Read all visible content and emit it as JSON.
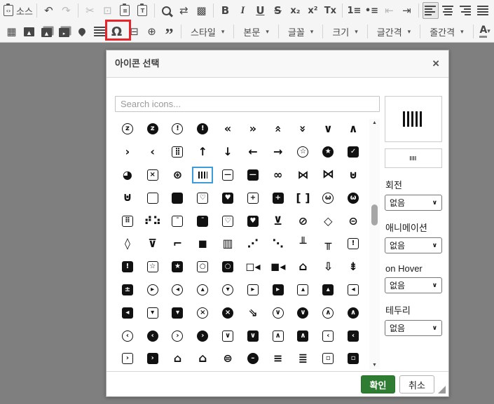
{
  "colors": {
    "overlay": "#7f7f7f",
    "toolbar_bg": "#f5f5f5",
    "dialog_header_bg": "#f8f8f8",
    "selection_blue": "#3d9bd9",
    "annotation_red": "#e8232a",
    "confirm_green": "#2e7d32",
    "icon_black": "#111111"
  },
  "toolbar": {
    "row1_groups": [
      [
        {
          "n": "source-button",
          "k": "src",
          "label": "소스"
        }
      ],
      [
        {
          "n": "undo-button",
          "k": "g",
          "g": "↶"
        },
        {
          "n": "redo-button",
          "k": "g",
          "g": "↷",
          "c": "disabled"
        }
      ],
      [
        {
          "n": "cut-button",
          "k": "g",
          "g": "✂",
          "c": "disabled"
        },
        {
          "n": "copy-button",
          "k": "g",
          "g": "⊡",
          "c": "disabled"
        },
        {
          "n": "paste-button",
          "k": "chip",
          "g": "≡"
        },
        {
          "n": "paste-from-word-button",
          "k": "chip",
          "g": "T"
        }
      ],
      [
        {
          "n": "find-button",
          "k": "mag"
        },
        {
          "n": "replace-button",
          "k": "g",
          "g": "⇄"
        },
        {
          "n": "select-all-button",
          "k": "g",
          "g": "▩"
        }
      ],
      [
        {
          "n": "bold-button",
          "k": "g",
          "g": "B",
          "c": "fB"
        },
        {
          "n": "italic-button",
          "k": "g",
          "g": "I",
          "c": "fI"
        },
        {
          "n": "underline-button",
          "k": "g",
          "g": "U",
          "c": "fU"
        },
        {
          "n": "strikethrough-button",
          "k": "g",
          "g": "S",
          "c": "fS"
        },
        {
          "n": "subscript-button",
          "k": "g",
          "g": "x₂",
          "c": "fTx"
        },
        {
          "n": "superscript-button",
          "k": "g",
          "g": "x²",
          "c": "fTx"
        },
        {
          "n": "remove-format-button",
          "k": "g",
          "g": "Tx",
          "c": "fTx"
        }
      ],
      [
        {
          "n": "numbered-list-button",
          "k": "g",
          "g": "1≡",
          "c": "fTx"
        },
        {
          "n": "bulleted-list-button",
          "k": "g",
          "g": "•≡",
          "c": "fTx"
        },
        {
          "n": "outdent-button",
          "k": "g",
          "g": "⇤",
          "c": "disabled"
        },
        {
          "n": "indent-button",
          "k": "g",
          "g": "⇥"
        }
      ],
      [
        {
          "n": "align-left-button",
          "k": "bars",
          "dir": "left",
          "c": "active"
        },
        {
          "n": "align-center-button",
          "k": "bars",
          "dir": "center"
        },
        {
          "n": "align-right-button",
          "k": "bars",
          "dir": "right"
        },
        {
          "n": "justify-button",
          "k": "bars",
          "dir": "justify"
        }
      ]
    ],
    "row2_groups": [
      [
        {
          "n": "table-button",
          "k": "g",
          "g": "▦"
        },
        {
          "n": "image-button",
          "k": "cdark",
          "g": "▲"
        },
        {
          "n": "image-gallery-button",
          "k": "cdark",
          "g": "▲",
          "c": "stack"
        },
        {
          "n": "video-button",
          "k": "cdark",
          "g": "▸",
          "c": "stack"
        },
        {
          "n": "map-pin-button",
          "k": "pin"
        },
        {
          "n": "horizontal-rule-button",
          "k": "bars",
          "dir": "justify"
        },
        {
          "n": "special-char-button",
          "k": "g",
          "g": "Ω",
          "c": "omega"
        },
        {
          "n": "page-break-button",
          "k": "g",
          "g": "⊟"
        },
        {
          "n": "iframe-button",
          "k": "g",
          "g": "⊕"
        },
        {
          "n": "blockquote-button",
          "k": "g",
          "g": "”",
          "c": "bigq"
        }
      ],
      [
        {
          "n": "style-dropdown",
          "k": "drop",
          "label": "스타일"
        }
      ],
      [
        {
          "n": "format-dropdown",
          "k": "drop",
          "label": "본문"
        }
      ],
      [
        {
          "n": "font-dropdown",
          "k": "drop",
          "label": "글꼴"
        }
      ],
      [
        {
          "n": "size-dropdown",
          "k": "drop",
          "label": "크기"
        }
      ],
      [
        {
          "n": "letter-spacing-dropdown",
          "k": "drop",
          "label": "글간격"
        }
      ],
      [
        {
          "n": "line-height-dropdown",
          "k": "drop",
          "label": "줄간격"
        }
      ],
      [
        {
          "n": "text-color-button",
          "k": "colorA"
        },
        {
          "n": "bg-color-button",
          "k": "bgA"
        }
      ]
    ]
  },
  "dialog": {
    "title": "아이콘 선택",
    "close_glyph": "×",
    "search_placeholder": "Search icons...",
    "selected_icon": "barcode-read",
    "confirm_label": "확인",
    "cancel_label": "취소",
    "options": [
      {
        "name": "rotation-select",
        "label": "회전",
        "value": "없음"
      },
      {
        "name": "animation-select",
        "label": "애니메이션",
        "value": "없음"
      },
      {
        "name": "hover-select",
        "label": "on Hover",
        "value": "없음"
      },
      {
        "name": "border-select",
        "label": "테두리",
        "value": "없음"
      }
    ],
    "icon_grid": {
      "columns": 10,
      "icons": [
        [
          "alarm-snooze",
          "co",
          "z"
        ],
        [
          "alarm-snooze-solid",
          "cf",
          "z"
        ],
        [
          "alarm-exclamation",
          "co",
          "!"
        ],
        [
          "alarm-exclamation-solid",
          "cf",
          "!"
        ],
        [
          "angle-double-left",
          "p",
          "«"
        ],
        [
          "angle-double-right",
          "p",
          "»"
        ],
        [
          "angle-double-up",
          "p",
          "«",
          "r"
        ],
        [
          "angle-double-down",
          "p",
          "»",
          "r"
        ],
        [
          "angle-down",
          "p",
          "∨"
        ],
        [
          "angle-up",
          "p",
          "∧"
        ],
        [
          "angle-right",
          "p",
          "›"
        ],
        [
          "angle-left",
          "p",
          "‹"
        ],
        [
          "cash-register",
          "so",
          "⣿"
        ],
        [
          "arrow-up",
          "p",
          "↑"
        ],
        [
          "arrow-down",
          "p",
          "↓"
        ],
        [
          "arrow-left",
          "p",
          "←"
        ],
        [
          "arrow-right",
          "p",
          "→"
        ],
        [
          "award",
          "co",
          "☆"
        ],
        [
          "award-solid",
          "cf",
          "★"
        ],
        [
          "shopping-bag",
          "sf",
          "✓"
        ],
        [
          "ball-pile",
          "p",
          "◕"
        ],
        [
          "ballot-x",
          "so",
          "×"
        ],
        [
          "basketball",
          "p",
          "⊛"
        ],
        [
          "barcode-read",
          "bar",
          "",
          "s"
        ],
        [
          "blanket",
          "so",
          "—"
        ],
        [
          "blanket-solid",
          "sf",
          "—"
        ],
        [
          "binoculars",
          "p",
          "∞"
        ],
        [
          "bone",
          "p",
          "⋈"
        ],
        [
          "bone-solid",
          "p",
          "⋈",
          "t"
        ],
        [
          "flask",
          "p",
          "⊍"
        ],
        [
          "flask-solid",
          "p",
          "⊍",
          "t"
        ],
        [
          "book",
          "so",
          ""
        ],
        [
          "book-solid",
          "sf",
          ""
        ],
        [
          "book-heart",
          "so",
          "♡"
        ],
        [
          "book-heart-solid",
          "sf",
          "♥"
        ],
        [
          "book-medical",
          "so",
          "+"
        ],
        [
          "book-medical-solid",
          "sf",
          "+"
        ],
        [
          "brackets",
          "p",
          "[ ]"
        ],
        [
          "brain",
          "co",
          "ω"
        ],
        [
          "brain-solid",
          "cf",
          "ω"
        ],
        [
          "braille",
          "so",
          "⠿"
        ],
        [
          "braille-dots",
          "p",
          "⠞⠵"
        ],
        [
          "browser",
          "so",
          "¯"
        ],
        [
          "browser-solid",
          "sf",
          "¯"
        ],
        [
          "calendar-heart",
          "so",
          "♡"
        ],
        [
          "calendar-heart-solid",
          "sf",
          "♥"
        ],
        [
          "glass-citrus",
          "p",
          "⊻"
        ],
        [
          "test-tube",
          "p",
          "⊘"
        ],
        [
          "cone",
          "p",
          "◇"
        ],
        [
          "capsule",
          "p",
          "⊝"
        ],
        [
          "eraser",
          "p",
          "◊"
        ],
        [
          "martini-glass",
          "p",
          "⊽"
        ],
        [
          "cctv",
          "p",
          "⌐"
        ],
        [
          "cctv-solid",
          "p",
          "◼"
        ],
        [
          "headboard",
          "p",
          "▥"
        ],
        [
          "chart-network",
          "p",
          "⋰"
        ],
        [
          "chart-network-alt",
          "p",
          "⋱"
        ],
        [
          "network-nodes",
          "p",
          "╨"
        ],
        [
          "network-nodes-solid",
          "p",
          "╥"
        ],
        [
          "calendar-exclamation",
          "so",
          "!"
        ],
        [
          "calendar-exclamation-solid",
          "sf",
          "!"
        ],
        [
          "calendar-star",
          "so",
          "☆"
        ],
        [
          "calendar-star-solid",
          "sf",
          "★"
        ],
        [
          "webcam",
          "so",
          "○"
        ],
        [
          "webcam-solid",
          "sf",
          "○"
        ],
        [
          "camera-movie",
          "p",
          "◻◂"
        ],
        [
          "camera-movie-solid",
          "p",
          "◼◂"
        ],
        [
          "backpack",
          "p",
          "⌂",
          "t"
        ],
        [
          "cart-arrow-down",
          "p",
          "⇩"
        ],
        [
          "cart-arrow-down-solid",
          "p",
          "⇟"
        ],
        [
          "car-battery",
          "sf",
          "±"
        ],
        [
          "caret-circle-right",
          "co",
          "▸"
        ],
        [
          "caret-circle-left",
          "co",
          "◂"
        ],
        [
          "caret-circle-up",
          "co",
          "▴"
        ],
        [
          "caret-circle-down",
          "co",
          "▾"
        ],
        [
          "caret-square-right",
          "so",
          "▸"
        ],
        [
          "caret-square-right-solid",
          "sf",
          "▸"
        ],
        [
          "caret-square-up",
          "so",
          "▴"
        ],
        [
          "caret-square-up-solid",
          "sf",
          "▴"
        ],
        [
          "caret-square-left",
          "so",
          "◂"
        ],
        [
          "caret-square-left-solid",
          "sf",
          "◂"
        ],
        [
          "caret-square-down",
          "so",
          "▾"
        ],
        [
          "caret-square-down-solid",
          "sf",
          "▾"
        ],
        [
          "shield-x",
          "co",
          "×"
        ],
        [
          "shield-x-solid",
          "cf",
          "×"
        ],
        [
          "chart-line-down",
          "p",
          "⇘"
        ],
        [
          "chevron-circle-down",
          "co",
          "∨"
        ],
        [
          "chevron-circle-down-solid",
          "cf",
          "∨"
        ],
        [
          "chevron-circle-up",
          "co",
          "∧"
        ],
        [
          "chevron-circle-up-solid",
          "cf",
          "∧"
        ],
        [
          "chevron-circle-left",
          "co",
          "‹"
        ],
        [
          "chevron-circle-left-solid",
          "cf",
          "‹"
        ],
        [
          "chevron-circle-right",
          "co",
          "›"
        ],
        [
          "chevron-circle-right-solid",
          "cf",
          "›"
        ],
        [
          "chevron-square-down",
          "so",
          "∨"
        ],
        [
          "chevron-square-down-solid",
          "sf",
          "∨"
        ],
        [
          "chevron-square-up",
          "so",
          "∧"
        ],
        [
          "chevron-square-up-solid",
          "sf",
          "∧"
        ],
        [
          "chevron-square-left",
          "so",
          "‹"
        ],
        [
          "chevron-square-left-solid",
          "sf",
          "‹"
        ],
        [
          "chevron-square-right",
          "so",
          "›"
        ],
        [
          "chevron-square-right-solid",
          "sf",
          "›"
        ],
        [
          "church",
          "p",
          "⌂"
        ],
        [
          "church-solid",
          "p",
          "⌂",
          "t"
        ],
        [
          "drum",
          "p",
          "⊜"
        ],
        [
          "drum-solid",
          "cf",
          "–"
        ],
        [
          "database",
          "p",
          "≡"
        ],
        [
          "database-solid",
          "p",
          "≣"
        ],
        [
          "clone",
          "so",
          "▫"
        ],
        [
          "clone-solid",
          "sf",
          "▫"
        ]
      ]
    }
  }
}
